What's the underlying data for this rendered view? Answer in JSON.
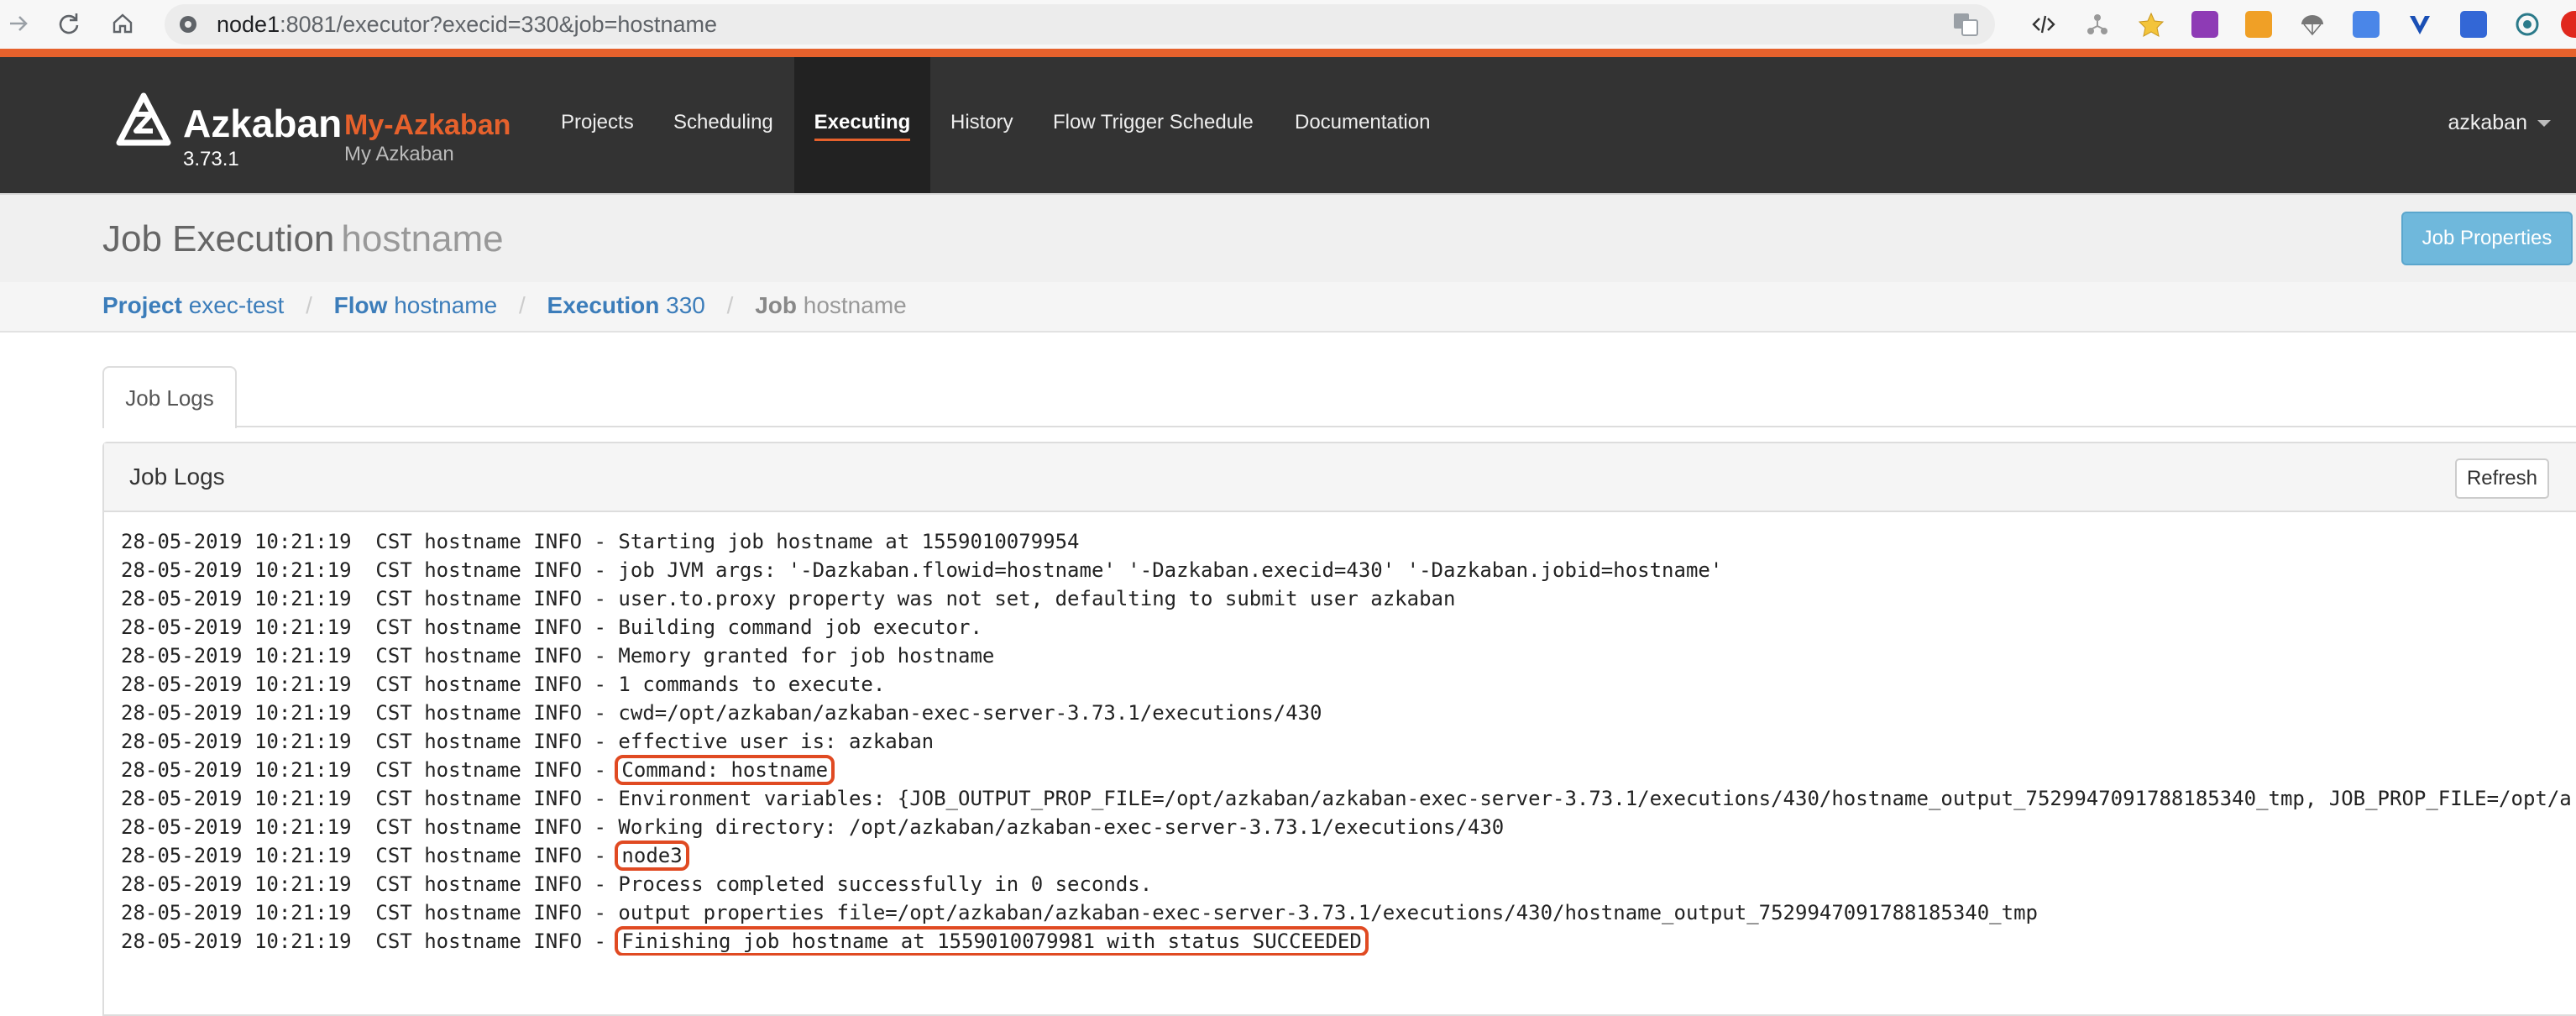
{
  "browser": {
    "url_host": "node1",
    "url_rest": ":8081/executor?execid=330&job=hostname"
  },
  "header": {
    "brand": "Azkaban",
    "version": "3.73.1",
    "env_name": "My-Azkaban",
    "env_desc": "My Azkaban",
    "nav": [
      {
        "label": "Projects",
        "active": false
      },
      {
        "label": "Scheduling",
        "active": false
      },
      {
        "label": "Executing",
        "active": true
      },
      {
        "label": "History",
        "active": false
      },
      {
        "label": "Flow Trigger Schedule",
        "active": false
      },
      {
        "label": "Documentation",
        "active": false
      }
    ],
    "user": "azkaban"
  },
  "title": {
    "main": "Job Execution",
    "sub": "hostname",
    "props_button": "Job Properties"
  },
  "breadcrumb": {
    "project_key": "Project",
    "project_val": "exec-test",
    "flow_key": "Flow",
    "flow_val": "hostname",
    "execution_key": "Execution",
    "execution_val": "330",
    "job_key": "Job",
    "job_val": "hostname",
    "sep": "/"
  },
  "tabs": {
    "job_logs": "Job Logs"
  },
  "panel": {
    "title": "Job Logs",
    "refresh_label": "Refresh"
  },
  "log": {
    "prefix": "28-05-2019 10:21:19  CST hostname INFO - ",
    "lines": [
      {
        "msg": "Starting job hostname at 1559010079954",
        "highlight": false
      },
      {
        "msg": "job JVM args: '-Dazkaban.flowid=hostname' '-Dazkaban.execid=430' '-Dazkaban.jobid=hostname'",
        "highlight": false
      },
      {
        "msg": "user.to.proxy property was not set, defaulting to submit user azkaban",
        "highlight": false
      },
      {
        "msg": "Building command job executor.",
        "highlight": false
      },
      {
        "msg": "Memory granted for job hostname",
        "highlight": false
      },
      {
        "msg": "1 commands to execute.",
        "highlight": false
      },
      {
        "msg": "cwd=/opt/azkaban/azkaban-exec-server-3.73.1/executions/430",
        "highlight": false
      },
      {
        "msg": "effective user is: azkaban",
        "highlight": false
      },
      {
        "msg": "Command: hostname",
        "highlight": true
      },
      {
        "msg": "Environment variables: {JOB_OUTPUT_PROP_FILE=/opt/azkaban/azkaban-exec-server-3.73.1/executions/430/hostname_output_7529947091788185340_tmp, JOB_PROP_FILE=/opt/az",
        "highlight": false
      },
      {
        "msg": "Working directory: /opt/azkaban/azkaban-exec-server-3.73.1/executions/430",
        "highlight": false
      },
      {
        "msg": "node3",
        "highlight": true
      },
      {
        "msg": "Process completed successfully in 0 seconds.",
        "highlight": false
      },
      {
        "msg": "output properties file=/opt/azkaban/azkaban-exec-server-3.73.1/executions/430/hostname_output_7529947091788185340_tmp",
        "highlight": false
      },
      {
        "msg": "Finishing job hostname at 1559010079981 with status SUCCEEDED",
        "highlight": true
      }
    ]
  },
  "colors": {
    "accent": "#e6612c",
    "header_bg": "#333333",
    "link": "#3c7dba",
    "highlight_box": "#e04a22",
    "props_button": "#6fb8dc"
  }
}
